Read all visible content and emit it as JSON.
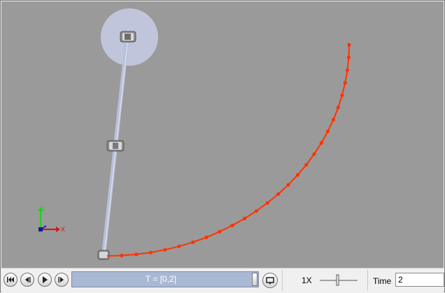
{
  "viewport": {
    "background": "#9a9a9a",
    "trail_color": "#ff3300",
    "link_color": "#b8c0d8",
    "highlight_color": "#c8cde6",
    "axes": {
      "x_label": "X",
      "y_label": "Y"
    }
  },
  "controls": {
    "timeline_label": "T = [0,2]",
    "speed_label": "1X",
    "time_label": "Time",
    "time_value": "2"
  },
  "icons": {
    "first": "skip-to-start-icon",
    "step_back": "step-back-icon",
    "play": "play-icon",
    "step_forward": "step-forward-icon",
    "loop": "loop-playback-icon"
  }
}
